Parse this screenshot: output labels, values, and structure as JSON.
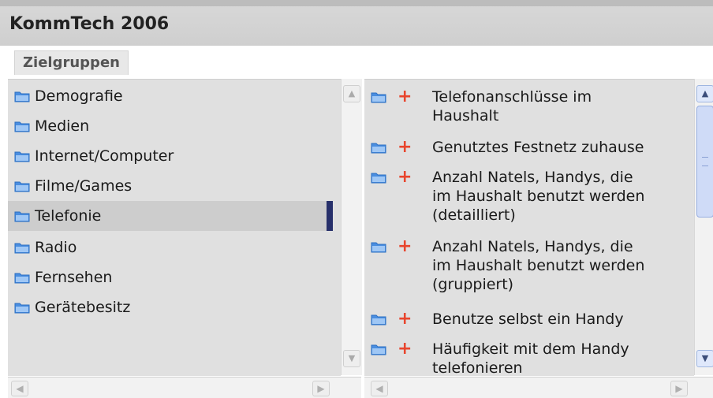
{
  "window": {
    "title": "KommTech 2006"
  },
  "tabs": [
    {
      "label": "Zielgruppen"
    }
  ],
  "left_list": {
    "items": [
      {
        "label": "Demografie"
      },
      {
        "label": "Medien"
      },
      {
        "label": "Internet/Computer"
      },
      {
        "label": "Filme/Games"
      },
      {
        "label": "Telefonie",
        "selected": true
      },
      {
        "label": "Radio"
      },
      {
        "label": "Fernsehen"
      },
      {
        "label": "Gerätebesitz"
      }
    ]
  },
  "right_list": {
    "items": [
      {
        "line1": "Telefonanschlüsse im",
        "line2": "Haushalt",
        "line3": ""
      },
      {
        "line1": "Genutztes Festnetz zuhause",
        "line2": "",
        "line3": ""
      },
      {
        "line1": "Anzahl Natels, Handys, die",
        "line2": "im Haushalt benutzt werden",
        "line3": "(detailliert)"
      },
      {
        "line1": "Anzahl Natels, Handys, die",
        "line2": "im Haushalt benutzt werden",
        "line3": "(gruppiert)"
      },
      {
        "line1": "Benutze selbst ein Handy",
        "line2": "",
        "line3": ""
      },
      {
        "line1": "Häufigkeit mit dem Handy",
        "line2": "telefonieren",
        "line3": ""
      }
    ]
  },
  "icons": {
    "folder": "folder-icon",
    "add": "plus-icon"
  },
  "colors": {
    "accent": "#27306b",
    "plus": "#e8452d",
    "folder": "#4a8ee0"
  }
}
